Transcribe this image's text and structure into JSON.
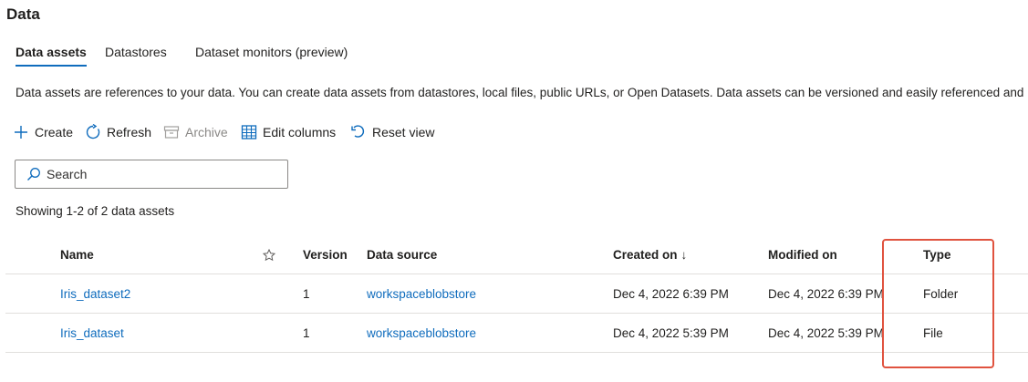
{
  "page": {
    "title": "Data"
  },
  "tabs": [
    {
      "label": "Data assets",
      "active": true
    },
    {
      "label": "Datastores",
      "active": false
    },
    {
      "label": "Dataset monitors (preview)",
      "active": false
    }
  ],
  "description": "Data assets are references to your data. You can create data assets from datastores, local files, public URLs, or Open Datasets. Data assets can be versioned and easily referenced and",
  "toolbar": {
    "create_label": "Create",
    "refresh_label": "Refresh",
    "archive_label": "Archive",
    "edit_columns_label": "Edit columns",
    "reset_view_label": "Reset view"
  },
  "search": {
    "placeholder": "Search",
    "value": ""
  },
  "showing_text": "Showing 1-2 of 2 data assets",
  "table": {
    "headers": {
      "name": "Name",
      "version": "Version",
      "data_source": "Data source",
      "created_on": "Created on",
      "created_sort": "↓",
      "modified_on": "Modified on",
      "type": "Type"
    },
    "rows": [
      {
        "name": "Iris_dataset2",
        "version": "1",
        "data_source": "workspaceblobstore",
        "created_on": "Dec 4, 2022 6:39 PM",
        "modified_on": "Dec 4, 2022 6:39 PM",
        "type": "Folder"
      },
      {
        "name": "Iris_dataset",
        "version": "1",
        "data_source": "workspaceblobstore",
        "created_on": "Dec 4, 2022 5:39 PM",
        "modified_on": "Dec 4, 2022 5:39 PM",
        "type": "File"
      }
    ]
  },
  "colors": {
    "accent": "#0f6cbd",
    "highlight": "#e0533f",
    "disabled": "#8a8886"
  },
  "icons": {
    "create": "plus-icon",
    "refresh": "refresh-icon",
    "archive": "archive-icon",
    "edit_columns": "table-icon",
    "reset_view": "undo-icon",
    "search": "search-icon",
    "favorite": "star-icon"
  }
}
